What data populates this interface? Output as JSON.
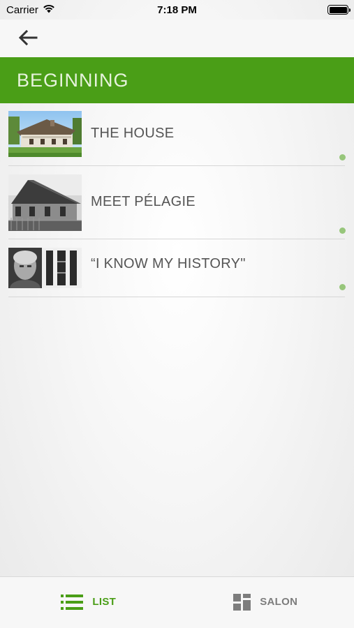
{
  "status_bar": {
    "carrier": "Carrier",
    "time": "7:18 PM",
    "wifi_icon": "wifi-icon",
    "battery_icon": "battery-icon"
  },
  "nav": {
    "back_icon": "arrow-left-icon"
  },
  "section": {
    "title": "BEGINNING",
    "color": "#4a9e17"
  },
  "items": [
    {
      "title": "THE HOUSE",
      "image": "house-photo"
    },
    {
      "title": "MEET PÉLAGIE",
      "image": "historic-house-photo"
    },
    {
      "title": "“I KNOW MY HISTORY\"",
      "image": "woman-portrait-photo"
    }
  ],
  "tabs": [
    {
      "label": "LIST",
      "icon": "list-icon",
      "active": true,
      "color": "#4a9e17"
    },
    {
      "label": "SALON",
      "icon": "grid-icon",
      "active": false,
      "color": "#7d7d7d"
    }
  ]
}
